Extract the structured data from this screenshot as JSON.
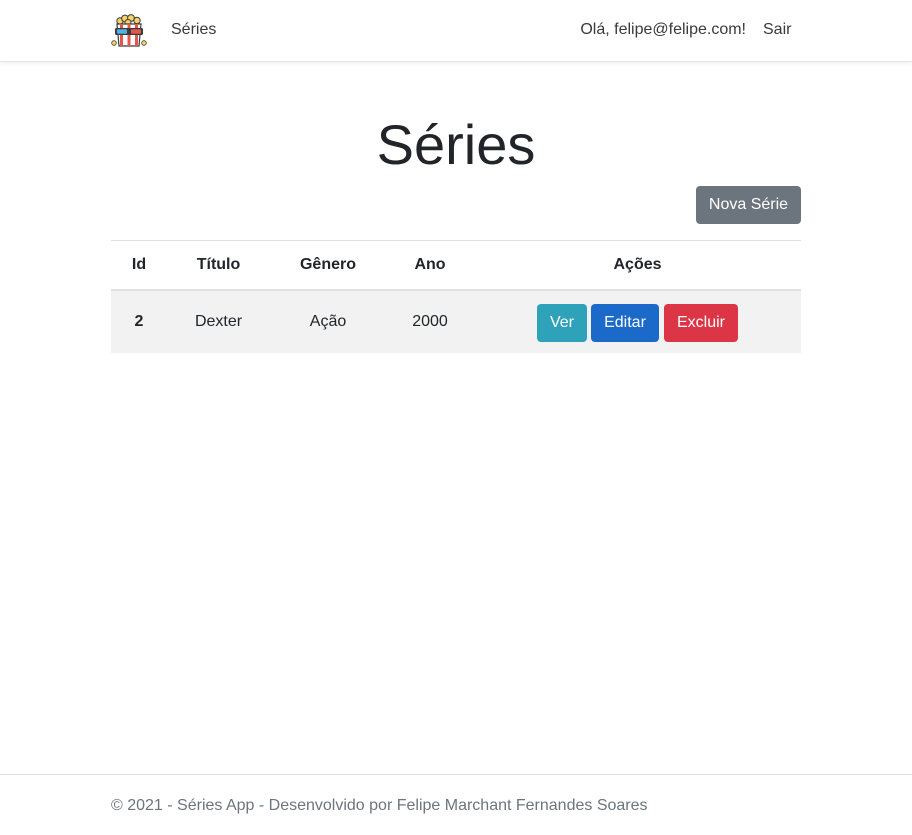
{
  "navbar": {
    "logo_icon": "popcorn-3d-glasses-icon",
    "series_link": "Séries",
    "greeting": "Olá, felipe@felipe.com!",
    "logout": "Sair"
  },
  "page": {
    "title": "Séries",
    "new_button": "Nova Série"
  },
  "table": {
    "headers": [
      "Id",
      "Título",
      "Gênero",
      "Ano",
      "Ações"
    ],
    "rows": [
      {
        "id": "2",
        "title": "Dexter",
        "genre": "Ação",
        "year": "2000",
        "actions": [
          "Ver",
          "Editar",
          "Excluir"
        ]
      }
    ]
  },
  "footer": {
    "text": "© 2021 - Séries App - Desenvolvido por Felipe Marchant Fernandes Soares"
  },
  "colors": {
    "secondary": "#6c757d",
    "info": "#2ea2b8",
    "primary": "#1b6ac9",
    "danger": "#dc3545",
    "row_stripe": "#f2f2f2"
  }
}
